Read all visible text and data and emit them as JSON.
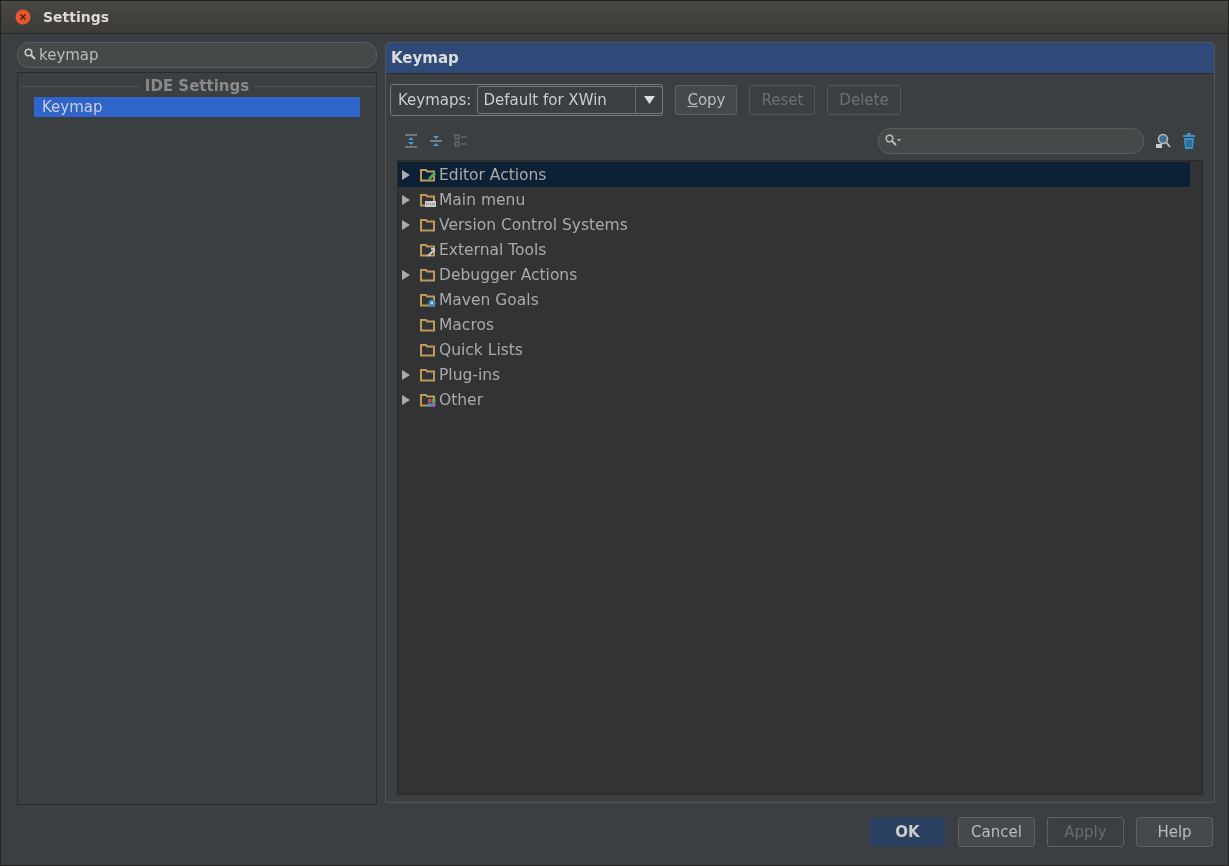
{
  "window": {
    "title": "Settings"
  },
  "sidebar": {
    "search": {
      "value": "keymap"
    },
    "section": "IDE Settings",
    "items": [
      {
        "label": "Keymap",
        "selected": true
      }
    ]
  },
  "panel": {
    "title": "Keymap",
    "keymaps_label": "Keymaps:",
    "keymap_value": "Default for XWin",
    "buttons": [
      {
        "label": "Copy",
        "disabled": false,
        "mnemonic": true
      },
      {
        "label": "Reset",
        "disabled": true,
        "mnemonic": false
      },
      {
        "label": "Delete",
        "disabled": true,
        "mnemonic": false
      }
    ],
    "tree": [
      {
        "label": "Editor Actions",
        "kind": "edit",
        "expandable": true,
        "selected": true
      },
      {
        "label": "Main menu",
        "kind": "menu",
        "expandable": true,
        "selected": false
      },
      {
        "label": "Version Control Systems",
        "kind": "plain",
        "expandable": true,
        "selected": false
      },
      {
        "label": "External Tools",
        "kind": "tools",
        "expandable": false,
        "selected": false
      },
      {
        "label": "Debugger Actions",
        "kind": "plain",
        "expandable": true,
        "selected": false
      },
      {
        "label": "Maven Goals",
        "kind": "gear",
        "expandable": false,
        "selected": false
      },
      {
        "label": "Macros",
        "kind": "plain",
        "expandable": false,
        "selected": false
      },
      {
        "label": "Quick Lists",
        "kind": "plain",
        "expandable": false,
        "selected": false
      },
      {
        "label": "Plug-ins",
        "kind": "plain",
        "expandable": true,
        "selected": false
      },
      {
        "label": "Other",
        "kind": "grid",
        "expandable": true,
        "selected": false
      }
    ]
  },
  "dialog_buttons": [
    {
      "label": "OK",
      "default": true,
      "disabled": false
    },
    {
      "label": "Cancel",
      "default": false,
      "disabled": false
    },
    {
      "label": "Apply",
      "default": false,
      "disabled": true
    },
    {
      "label": "Help",
      "default": false,
      "disabled": false
    }
  ]
}
